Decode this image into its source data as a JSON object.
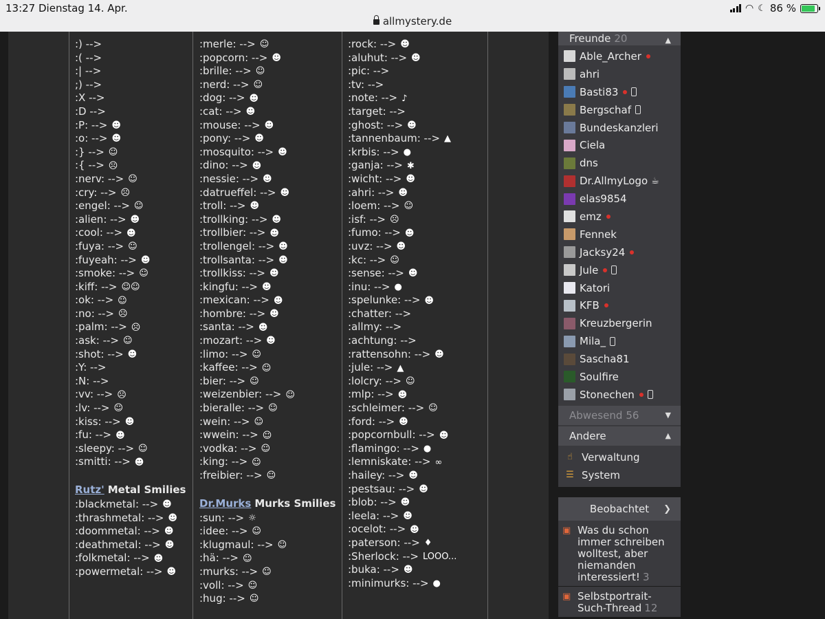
{
  "status": {
    "time": "13:27",
    "date": "Dienstag 14. Apr.",
    "url": "allmystery.de",
    "battery": "86 %",
    "battery_level": 0.86
  },
  "col1": [
    {
      "code": ":) -->",
      "emo": ""
    },
    {
      "code": ":( -->",
      "emo": ""
    },
    {
      "code": ":| -->",
      "emo": ""
    },
    {
      "code": ";) -->",
      "emo": ""
    },
    {
      "code": ":X -->",
      "emo": ""
    },
    {
      "code": ":D -->",
      "emo": ""
    },
    {
      "code": ":P: -->",
      "emo": "☻"
    },
    {
      "code": ":o: -->",
      "emo": "☻"
    },
    {
      "code": ":} -->",
      "emo": "☺"
    },
    {
      "code": ":{ -->",
      "emo": "☹"
    },
    {
      "code": ":nerv: -->",
      "emo": "☺"
    },
    {
      "code": ":cry: -->",
      "emo": "☹"
    },
    {
      "code": ":engel: -->",
      "emo": "☺"
    },
    {
      "code": ":alien: -->",
      "emo": "☻"
    },
    {
      "code": ":cool: -->",
      "emo": "☻"
    },
    {
      "code": ":fuya: -->",
      "emo": "☺"
    },
    {
      "code": ":fuyeah: -->",
      "emo": "☻"
    },
    {
      "code": ":smoke: -->",
      "emo": "☺"
    },
    {
      "code": ":kiff: -->",
      "emo": "☺☺"
    },
    {
      "code": ":ok: -->",
      "emo": "☺"
    },
    {
      "code": ":no: -->",
      "emo": "☹"
    },
    {
      "code": ":palm: -->",
      "emo": "☹"
    },
    {
      "code": ":ask: -->",
      "emo": "☺"
    },
    {
      "code": ":shot: -->",
      "emo": "☻"
    },
    {
      "code": ":Y: -->",
      "emo": ""
    },
    {
      "code": ":N: -->",
      "emo": ""
    },
    {
      "code": ":vv: -->",
      "emo": "☹"
    },
    {
      "code": ":lv: -->",
      "emo": "☺"
    },
    {
      "code": ":kiss: -->",
      "emo": "☻"
    },
    {
      "code": ":fu: -->",
      "emo": "☻"
    },
    {
      "code": ":sleepy: -->",
      "emo": "☺"
    },
    {
      "code": ":smitti: -->",
      "emo": "☻"
    }
  ],
  "col1_heading": {
    "author": "Rutz'",
    "title": "Metal Smilies"
  },
  "col1_metal": [
    {
      "code": ":blackmetal: -->",
      "emo": "☻"
    },
    {
      "code": ":thrashmetal: -->",
      "emo": "☻"
    },
    {
      "code": ":doommetal: -->",
      "emo": "☻"
    },
    {
      "code": ":deathmetal: -->",
      "emo": "☻"
    },
    {
      "code": ":folkmetal: -->",
      "emo": "☻"
    },
    {
      "code": ":powermetal: -->",
      "emo": "☻"
    }
  ],
  "col2": [
    {
      "code": ":merle: -->",
      "emo": "☺"
    },
    {
      "code": ":popcorn: -->",
      "emo": "☻"
    },
    {
      "code": ":brille: -->",
      "emo": "☺"
    },
    {
      "code": ":nerd: -->",
      "emo": "☺"
    },
    {
      "code": ":dog: -->",
      "emo": "☻"
    },
    {
      "code": ":cat: -->",
      "emo": "☻"
    },
    {
      "code": ":mouse: -->",
      "emo": "☻"
    },
    {
      "code": ":pony: -->",
      "emo": "☻"
    },
    {
      "code": ":mosquito: -->",
      "emo": "☻"
    },
    {
      "code": ":dino: -->",
      "emo": "☻"
    },
    {
      "code": ":nessie: -->",
      "emo": "☻"
    },
    {
      "code": ":datrueffel: -->",
      "emo": "☻"
    },
    {
      "code": ":troll: -->",
      "emo": "☻"
    },
    {
      "code": ":trollking: -->",
      "emo": "☻"
    },
    {
      "code": ":trollbier: -->",
      "emo": "☻"
    },
    {
      "code": ":trollengel: -->",
      "emo": "☻"
    },
    {
      "code": ":trollsanta: -->",
      "emo": "☻"
    },
    {
      "code": ":trollkiss: -->",
      "emo": "☻"
    },
    {
      "code": ":kingfu: -->",
      "emo": "☻"
    },
    {
      "code": ":mexican: -->",
      "emo": "☻"
    },
    {
      "code": ":hombre: -->",
      "emo": "☻"
    },
    {
      "code": ":santa: -->",
      "emo": "☻"
    },
    {
      "code": ":mozart: -->",
      "emo": "☻"
    },
    {
      "code": ":limo: -->",
      "emo": "☺"
    },
    {
      "code": ":kaffee: -->",
      "emo": "☺"
    },
    {
      "code": ":bier: -->",
      "emo": "☺"
    },
    {
      "code": ":weizenbier: -->",
      "emo": "☺"
    },
    {
      "code": ":bieralle: -->",
      "emo": "☺"
    },
    {
      "code": ":wein: -->",
      "emo": "☺"
    },
    {
      "code": ":wwein: -->",
      "emo": "☺"
    },
    {
      "code": ":vodka: -->",
      "emo": "☺"
    },
    {
      "code": ":king: -->",
      "emo": "☺"
    },
    {
      "code": ":freibier: -->",
      "emo": "☺"
    }
  ],
  "col2_heading": {
    "author": "Dr.Murks",
    "title": "Murks Smilies"
  },
  "col2_murks": [
    {
      "code": ":sun: -->",
      "emo": "☼"
    },
    {
      "code": ":idee: -->",
      "emo": "☺"
    },
    {
      "code": ":klugmaul: -->",
      "emo": "☺"
    },
    {
      "code": ":hä: -->",
      "emo": "☺"
    },
    {
      "code": ":murks: -->",
      "emo": "☺"
    },
    {
      "code": ":voll: -->",
      "emo": "☺"
    },
    {
      "code": ":hug: -->",
      "emo": "☺"
    }
  ],
  "col3": [
    {
      "code": ":rock: -->",
      "emo": "☻"
    },
    {
      "code": ":aluhut: -->",
      "emo": "☻"
    },
    {
      "code": ":pic: -->",
      "emo": ""
    },
    {
      "code": ":tv: -->",
      "emo": ""
    },
    {
      "code": ":note: -->",
      "emo": "♪"
    },
    {
      "code": ":target: -->",
      "emo": ""
    },
    {
      "code": ":ghost: -->",
      "emo": "☻"
    },
    {
      "code": ":tannenbaum: -->",
      "emo": "▲"
    },
    {
      "code": ":krbis: -->",
      "emo": "●"
    },
    {
      "code": ":ganja: -->",
      "emo": "✱"
    },
    {
      "code": ":wicht: -->",
      "emo": "☻"
    },
    {
      "code": ":ahri: -->",
      "emo": "☻"
    },
    {
      "code": ":loem: -->",
      "emo": "☺"
    },
    {
      "code": ":isf: -->",
      "emo": "☹"
    },
    {
      "code": ":fumo: -->",
      "emo": "☻"
    },
    {
      "code": ":uvz: -->",
      "emo": "☻"
    },
    {
      "code": ":kc: -->",
      "emo": "☺"
    },
    {
      "code": ":sense: -->",
      "emo": "☻"
    },
    {
      "code": ":inu: -->",
      "emo": "●"
    },
    {
      "code": ":spelunke: -->",
      "emo": "☻"
    },
    {
      "code": ":chatter: -->",
      "emo": ""
    },
    {
      "code": ":allmy: -->",
      "emo": ""
    },
    {
      "code": ":achtung: -->",
      "emo": ""
    },
    {
      "code": ":rattensohn: -->",
      "emo": "☻"
    },
    {
      "code": ":jule: -->",
      "emo": "▲"
    },
    {
      "code": ":lolcry: -->",
      "emo": "☺"
    },
    {
      "code": ":mlp: -->",
      "emo": "☻"
    },
    {
      "code": ":schleimer: -->",
      "emo": "☺"
    },
    {
      "code": ":ford: -->",
      "emo": "☻"
    },
    {
      "code": ":popcornbull: -->",
      "emo": "☻"
    },
    {
      "code": ":flamingo: -->",
      "emo": "●"
    },
    {
      "code": ":lemniskate: -->",
      "emo": "∞"
    },
    {
      "code": ":hailey: -->",
      "emo": "☻"
    },
    {
      "code": ":pestsau: -->",
      "emo": "☻"
    },
    {
      "code": ":blob: -->",
      "emo": "☻"
    },
    {
      "code": ":leela: -->",
      "emo": "☻"
    },
    {
      "code": ":ocelot: -->",
      "emo": "☻"
    },
    {
      "code": ":paterson: -->",
      "emo": "♦"
    },
    {
      "code": ":Sherlock: -->",
      "emo": "LOOO..."
    },
    {
      "code": ":buka: -->",
      "emo": "☻"
    },
    {
      "code": ":minimurks: -->",
      "emo": "●"
    }
  ],
  "sidebar": {
    "friends_label": "Freunde",
    "friends_count": "20",
    "friends": [
      {
        "name": "Able_Archer",
        "online": true,
        "mobile": false,
        "color": "#d8d8d8"
      },
      {
        "name": "ahri",
        "online": false,
        "mobile": false,
        "color": "#bbbbbb"
      },
      {
        "name": "Basti83",
        "online": true,
        "mobile": true,
        "color": "#4a7bb5"
      },
      {
        "name": "Bergschaf",
        "online": false,
        "mobile": true,
        "color": "#8a7a4a"
      },
      {
        "name": "Bundeskanzleri",
        "online": false,
        "mobile": false,
        "color": "#6a7a9a"
      },
      {
        "name": "Ciela",
        "online": false,
        "mobile": false,
        "color": "#d8a8c8"
      },
      {
        "name": "dns",
        "online": false,
        "mobile": false,
        "color": "#6b7a3a"
      },
      {
        "name": "Dr.AllmyLogo",
        "online": false,
        "mobile": false,
        "cup": true,
        "color": "#b03030"
      },
      {
        "name": "elas9854",
        "online": false,
        "mobile": false,
        "color": "#7a3ab0"
      },
      {
        "name": "emz",
        "online": true,
        "mobile": false,
        "color": "#e0e0e0"
      },
      {
        "name": "Fennek",
        "online": false,
        "mobile": false,
        "color": "#c89a6a"
      },
      {
        "name": "Jacksy24",
        "online": true,
        "mobile": false,
        "color": "#9a9a9a"
      },
      {
        "name": "Jule",
        "online": true,
        "mobile": true,
        "color": "#c8c8c8"
      },
      {
        "name": "Katori",
        "online": false,
        "mobile": false,
        "color": "#e8e8f0"
      },
      {
        "name": "KFB",
        "online": true,
        "mobile": false,
        "color": "#b8c0c8"
      },
      {
        "name": "Kreuzbergerin",
        "online": false,
        "mobile": false,
        "color": "#8a5a6a"
      },
      {
        "name": "Mila_",
        "online": false,
        "mobile": true,
        "color": "#8a9ab0"
      },
      {
        "name": "Sascha81",
        "online": false,
        "mobile": false,
        "color": "#5a4a3a"
      },
      {
        "name": "Soulfire",
        "online": false,
        "mobile": false,
        "color": "#2a5a2a"
      },
      {
        "name": "Stonechen",
        "online": true,
        "mobile": true,
        "color": "#9aa0a8"
      }
    ],
    "away_label": "Abwesend",
    "away_count": "56",
    "other_label": "Andere",
    "other_items": [
      {
        "label": "Verwaltung",
        "icon": "hand-icon"
      },
      {
        "label": "System",
        "icon": "document-icon"
      }
    ]
  },
  "watched": {
    "title": "Beobachtet",
    "items": [
      {
        "title": "Was du schon immer schreiben wolltest, aber niemanden interessiert!",
        "count": "3"
      },
      {
        "title": "Selbstportrait-Such-Thread",
        "count": "12"
      }
    ]
  }
}
